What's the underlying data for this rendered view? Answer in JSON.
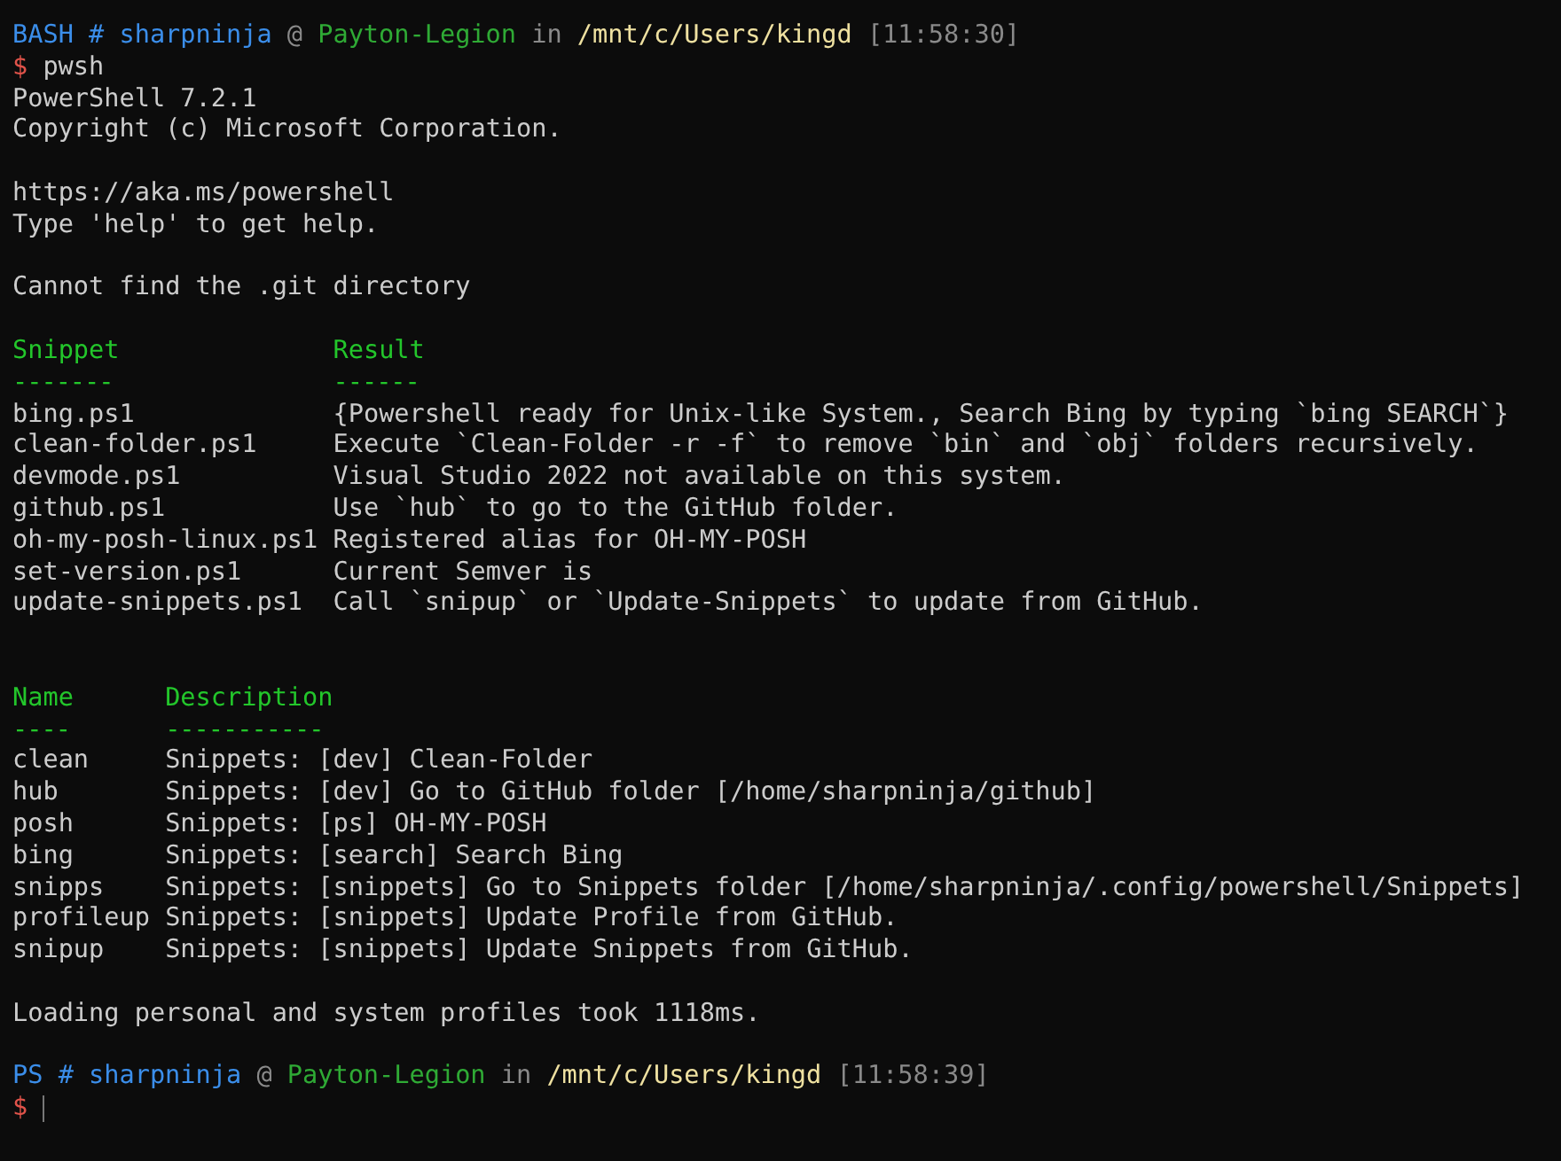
{
  "terminal": {
    "lines": [
      {
        "kind": "prompt",
        "segments": [
          {
            "kind": "shell",
            "text": "BASH"
          },
          {
            "kind": "shell",
            "text": "#"
          },
          {
            "kind": "user",
            "text": "sharpninja"
          },
          {
            "kind": "muted",
            "text": "@"
          },
          {
            "kind": "host",
            "text": "Payton-Legion"
          },
          {
            "kind": "muted",
            "text": "in"
          },
          {
            "kind": "path",
            "text": "/mnt/c/Users/kingd"
          },
          {
            "kind": "time",
            "text": "[11:58:30]"
          }
        ]
      },
      {
        "kind": "command",
        "symbol": "$",
        "command": "pwsh"
      },
      {
        "kind": "text",
        "text": "PowerShell 7.2.1"
      },
      {
        "kind": "text",
        "text": "Copyright (c) Microsoft Corporation."
      },
      {
        "kind": "blank"
      },
      {
        "kind": "text",
        "text": "https://aka.ms/powershell"
      },
      {
        "kind": "text",
        "text": "Type 'help' to get help."
      },
      {
        "kind": "blank"
      },
      {
        "kind": "text",
        "text": "Cannot find the .git directory"
      },
      {
        "kind": "blank"
      },
      {
        "kind": "table",
        "columns": [
          {
            "header": "Snippet",
            "rule": "-------"
          },
          {
            "header": "Result",
            "rule": "------"
          }
        ],
        "rows": [
          [
            "bing.ps1",
            "{Powershell ready for Unix-like System., Search Bing by typing `bing SEARCH`}"
          ],
          [
            "clean-folder.ps1",
            "Execute `Clean-Folder -r -f` to remove `bin` and `obj` folders recursively."
          ],
          [
            "devmode.ps1",
            "Visual Studio 2022 not available on this system."
          ],
          [
            "github.ps1",
            "Use `hub` to go to the GitHub folder."
          ],
          [
            "oh-my-posh-linux.ps1",
            "Registered alias for OH-MY-POSH"
          ],
          [
            "set-version.ps1",
            "Current Semver is"
          ],
          [
            "update-snippets.ps1",
            "Call `snipup` or `Update-Snippets` to update from GitHub."
          ]
        ]
      },
      {
        "kind": "blank"
      },
      {
        "kind": "blank"
      },
      {
        "kind": "table",
        "columns": [
          {
            "header": "Name",
            "rule": "----"
          },
          {
            "header": "Description",
            "rule": "-----------"
          }
        ],
        "rows": [
          [
            "clean",
            "Snippets: [dev] Clean-Folder"
          ],
          [
            "hub",
            "Snippets: [dev] Go to GitHub folder [/home/sharpninja/github]"
          ],
          [
            "posh",
            "Snippets: [ps] OH-MY-POSH"
          ],
          [
            "bing",
            "Snippets: [search] Search Bing"
          ],
          [
            "snipps",
            "Snippets: [snippets] Go to Snippets folder [/home/sharpninja/.config/powershell/Snippets]"
          ],
          [
            "profileup",
            "Snippets: [snippets] Update Profile from GitHub."
          ],
          [
            "snipup",
            "Snippets: [snippets] Update Snippets from GitHub."
          ]
        ]
      },
      {
        "kind": "blank"
      },
      {
        "kind": "text",
        "text": "Loading personal and system profiles took 1118ms."
      },
      {
        "kind": "blank"
      },
      {
        "kind": "prompt",
        "segments": [
          {
            "kind": "shell",
            "text": "PS"
          },
          {
            "kind": "shell",
            "text": "#"
          },
          {
            "kind": "user",
            "text": "sharpninja"
          },
          {
            "kind": "muted",
            "text": "@"
          },
          {
            "kind": "host",
            "text": "Payton-Legion"
          },
          {
            "kind": "muted",
            "text": "in"
          },
          {
            "kind": "path",
            "text": "/mnt/c/Users/kingd"
          },
          {
            "kind": "time",
            "text": "[11:58:39]"
          }
        ]
      },
      {
        "kind": "input",
        "symbol": "$"
      }
    ]
  }
}
